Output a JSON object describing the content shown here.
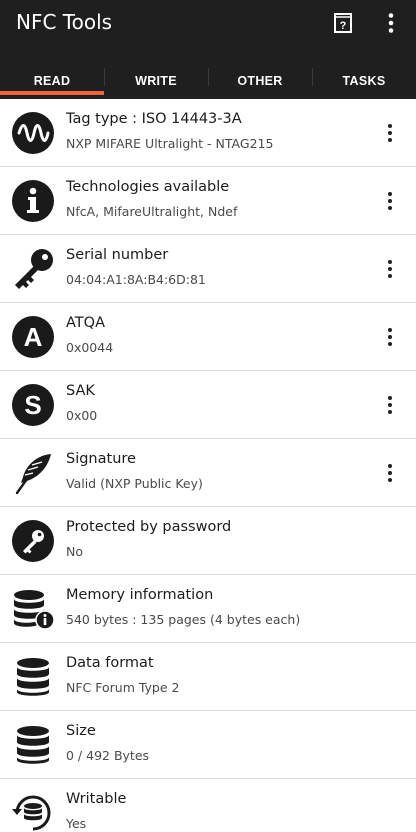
{
  "app": {
    "title": "NFC Tools"
  },
  "toolbar": {
    "help_icon": "help-book-icon",
    "menu_icon": "overflow-menu-icon"
  },
  "tabs": [
    {
      "label": "READ",
      "active": true
    },
    {
      "label": "WRITE",
      "active": false
    },
    {
      "label": "OTHER",
      "active": false
    },
    {
      "label": "TASKS",
      "active": false
    }
  ],
  "colors": {
    "appbar": "#1f1f1f",
    "accent": "#f0643c"
  },
  "items": [
    {
      "title": "Tag type : ISO 14443-3A",
      "value": "NXP MIFARE Ultralight - NTAG215",
      "icon": "wave-icon",
      "has_menu": true
    },
    {
      "title": "Technologies available",
      "value": "NfcA, MifareUltralight, Ndef",
      "icon": "info-icon",
      "has_menu": true
    },
    {
      "title": "Serial number",
      "value": "04:04:A1:8A:B4:6D:81",
      "icon": "key-icon",
      "has_menu": true
    },
    {
      "title": "ATQA",
      "value": "0x0044",
      "icon": "letter-a-icon",
      "has_menu": true
    },
    {
      "title": "SAK",
      "value": "0x00",
      "icon": "letter-s-icon",
      "has_menu": true
    },
    {
      "title": "Signature",
      "value": "Valid (NXP Public Key)",
      "icon": "feather-icon",
      "has_menu": true
    },
    {
      "title": "Protected by password",
      "value": "No",
      "icon": "key-circle-icon",
      "has_menu": false
    },
    {
      "title": "Memory information",
      "value": "540 bytes : 135 pages (4 bytes each)",
      "icon": "database-info-icon",
      "has_menu": false
    },
    {
      "title": "Data format",
      "value": "NFC Forum Type 2",
      "icon": "database-icon",
      "has_menu": false
    },
    {
      "title": "Size",
      "value": "0 / 492 Bytes",
      "icon": "database-icon",
      "has_menu": false
    },
    {
      "title": "Writable",
      "value": "Yes",
      "icon": "database-sync-icon",
      "has_menu": false
    }
  ]
}
